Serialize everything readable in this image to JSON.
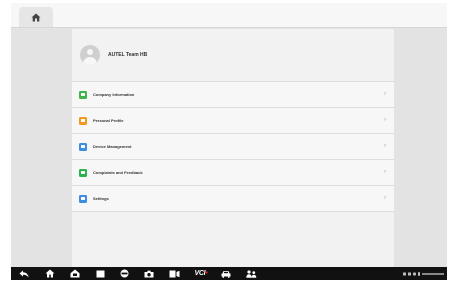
{
  "user": {
    "name": "AUTEL Team HB"
  },
  "menu": [
    {
      "label": "Company Information",
      "icon": "company-icon",
      "color": "#3cb44a"
    },
    {
      "label": "Personal Profile",
      "icon": "profile-icon",
      "color": "#f39a1e"
    },
    {
      "label": "Device Management",
      "icon": "device-icon",
      "color": "#3d8de0"
    },
    {
      "label": "Complaints and Feedback",
      "icon": "feedback-icon",
      "color": "#2bb24c"
    },
    {
      "label": "Settings",
      "icon": "settings-icon",
      "color": "#3d8de0"
    }
  ],
  "navbar": {
    "icons": [
      "back-icon",
      "home-icon",
      "house-icon",
      "window-icon",
      "browser-icon",
      "camera-icon",
      "screen-record-icon",
      "vci-icon",
      "car-icon",
      "people-icon"
    ],
    "vci_label": "VCI"
  },
  "colors": {
    "navbar": "#111111",
    "panel": "#f2f2f2",
    "background": "#e3e3e3"
  }
}
